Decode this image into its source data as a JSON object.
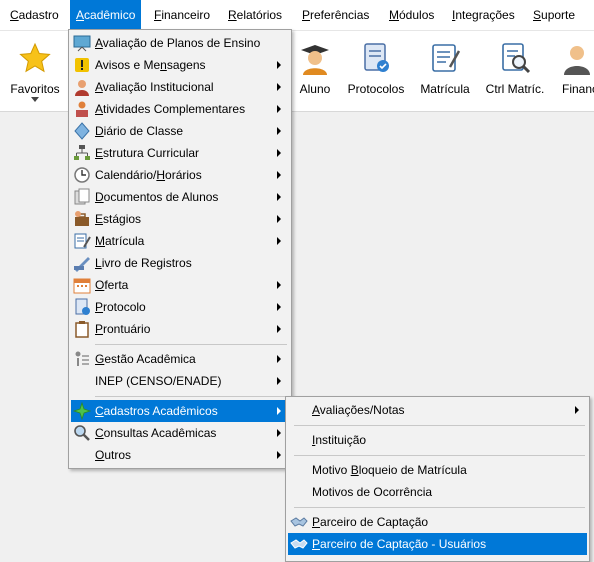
{
  "menubar": {
    "items": [
      {
        "pre": "",
        "ul": "C",
        "post": "adastro"
      },
      {
        "pre": "",
        "ul": "A",
        "post": "cadêmico"
      },
      {
        "pre": "",
        "ul": "F",
        "post": "inanceiro"
      },
      {
        "pre": "",
        "ul": "R",
        "post": "elatórios"
      },
      {
        "pre": "",
        "ul": "P",
        "post": "referências"
      },
      {
        "pre": "",
        "ul": "M",
        "post": "ódulos"
      },
      {
        "pre": "",
        "ul": "I",
        "post": "ntegrações"
      },
      {
        "pre": "",
        "ul": "S",
        "post": "uporte"
      }
    ]
  },
  "toolbar": {
    "favoritos": "Favoritos",
    "aluno": "Aluno",
    "protocolos": "Protocolos",
    "matricula": "Matrícula",
    "ctrl_matric": "Ctrl Matríc.",
    "financ": "Financ"
  },
  "academico_menu": {
    "items": [
      {
        "pre": "",
        "ul": "A",
        "post": "valiação de Planos de Ensino"
      },
      {
        "pre": "Avisos e Me",
        "ul": "n",
        "post": "sagens"
      },
      {
        "pre": "",
        "ul": "A",
        "post": "valiação Institucional"
      },
      {
        "pre": "",
        "ul": "A",
        "post": "tividades Complementares"
      },
      {
        "pre": "",
        "ul": "D",
        "post": "iário de Classe"
      },
      {
        "pre": "",
        "ul": "E",
        "post": "strutura Curricular"
      },
      {
        "pre": "Calendário/",
        "ul": "H",
        "post": "orários"
      },
      {
        "pre": "",
        "ul": "D",
        "post": "ocumentos de Alunos"
      },
      {
        "pre": "",
        "ul": "E",
        "post": "stágios"
      },
      {
        "pre": "",
        "ul": "M",
        "post": "atrícula"
      },
      {
        "pre": "",
        "ul": "L",
        "post": "ivro de Registros"
      },
      {
        "pre": "",
        "ul": "O",
        "post": "ferta"
      },
      {
        "pre": "",
        "ul": "P",
        "post": "rotocolo"
      },
      {
        "pre": "",
        "ul": "P",
        "post": "rontuário"
      },
      {
        "pre": "",
        "ul": "G",
        "post": "estão Acadêmica"
      },
      {
        "pre": "INEP (CENSO/ENADE)",
        "ul": "",
        "post": ""
      },
      {
        "pre": "",
        "ul": "C",
        "post": "adastros Acadêmicos"
      },
      {
        "pre": "",
        "ul": "C",
        "post": "onsultas Acadêmicas"
      },
      {
        "pre": "",
        "ul": "O",
        "post": "utros"
      }
    ]
  },
  "cadastros_submenu": {
    "items": [
      {
        "pre": "",
        "ul": "A",
        "post": "valiações/Notas"
      },
      {
        "pre": "",
        "ul": "I",
        "post": "nstituição"
      },
      {
        "pre": "Motivo ",
        "ul": "B",
        "post": "loqueio de Matrícula"
      },
      {
        "pre": "Motivos de Ocorrência",
        "ul": "",
        "post": ""
      },
      {
        "pre": "",
        "ul": "P",
        "post": "arceiro de Captação"
      },
      {
        "pre": "",
        "ul": "P",
        "post": "arceiro de Captação - Usuários"
      }
    ]
  },
  "colors": {
    "highlight": "#0078d7"
  }
}
